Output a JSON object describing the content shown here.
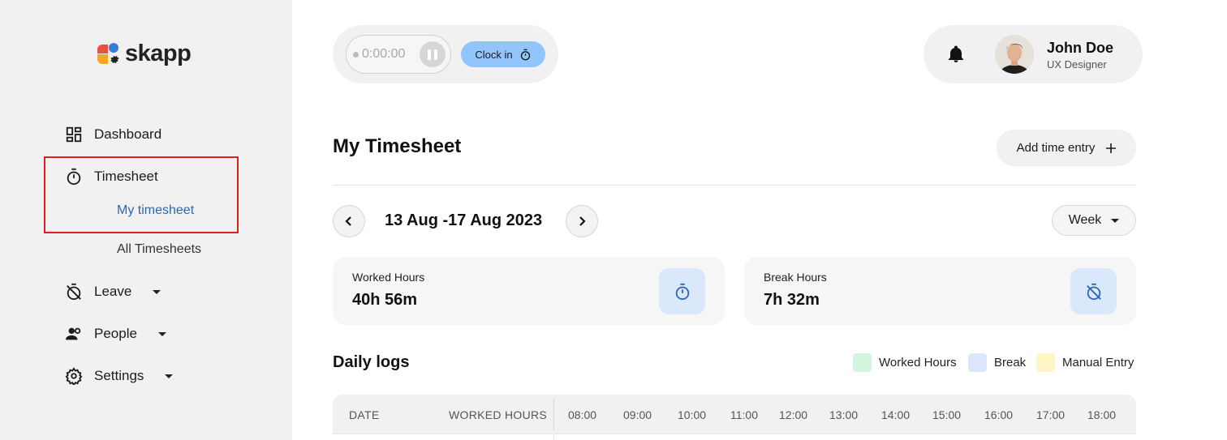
{
  "brand": {
    "name": "skapp"
  },
  "sidebar": {
    "items": [
      {
        "label": "Dashboard",
        "icon": "dashboard-icon"
      },
      {
        "label": "Timesheet",
        "icon": "stopwatch-icon"
      },
      {
        "label": "Leave",
        "icon": "timer-off-icon"
      },
      {
        "label": "People",
        "icon": "people-icon"
      },
      {
        "label": "Settings",
        "icon": "gear-icon"
      }
    ],
    "timesheet_sub": [
      {
        "label": "My timesheet",
        "active": true
      },
      {
        "label": "All Timesheets",
        "active": false
      }
    ]
  },
  "clock": {
    "timer": "0:00:00",
    "clock_in_label": "Clock in"
  },
  "user": {
    "name": "John Doe",
    "role": "UX Designer"
  },
  "page": {
    "title": "My Timesheet",
    "add_entry_label": "Add time entry",
    "date_range": "13 Aug -17 Aug 2023",
    "period_select": "Week"
  },
  "stats": [
    {
      "label": "Worked Hours",
      "value": "40h 56m",
      "icon": "stopwatch-icon"
    },
    {
      "label": "Break Hours",
      "value": "7h 32m",
      "icon": "timer-off-icon"
    }
  ],
  "daily_logs": {
    "title": "Daily logs",
    "legend": [
      {
        "label": "Worked Hours",
        "color": "#d3f5e0"
      },
      {
        "label": "Break",
        "color": "#dbe8fb"
      },
      {
        "label": "Manual Entry",
        "color": "#fdf6c4"
      }
    ],
    "columns": {
      "date": "DATE",
      "worked_hours": "WORKED HOURS"
    },
    "times": [
      "08:00",
      "09:00",
      "10:00",
      "11:00",
      "12:00",
      "13:00",
      "14:00",
      "15:00",
      "16:00",
      "17:00",
      "18:00"
    ]
  },
  "colors": {
    "accent": "#2e67b1",
    "clock_in_bg": "#93c5fd",
    "highlight": "#e01e1e",
    "icon_bg": "#dbe8fb"
  }
}
